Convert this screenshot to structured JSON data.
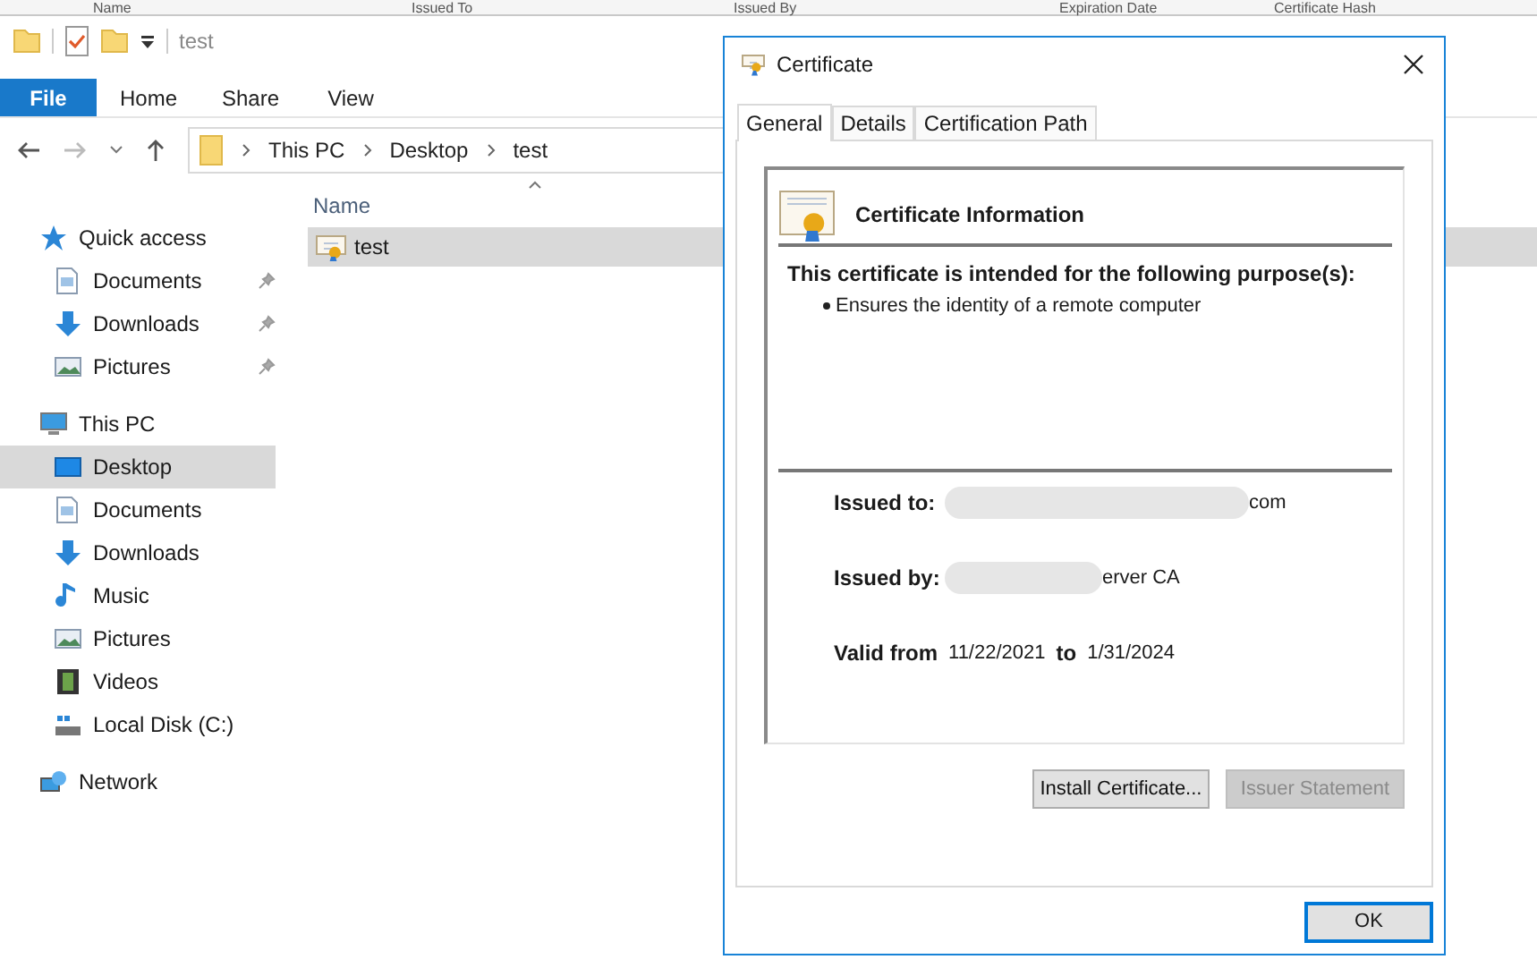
{
  "background_columns": [
    "Name",
    "Issued To",
    "Issued By",
    "Expiration Date",
    "Certificate Hash"
  ],
  "explorer": {
    "title": "test",
    "ribbon_tabs": [
      {
        "label": "File",
        "selected": true
      },
      {
        "label": "Home",
        "selected": false
      },
      {
        "label": "Share",
        "selected": false
      },
      {
        "label": "View",
        "selected": false
      }
    ],
    "breadcrumb": [
      "This PC",
      "Desktop",
      "test"
    ],
    "nav": [
      {
        "label": "Quick access",
        "kind": "star",
        "children": [
          {
            "label": "Documents",
            "kind": "documents",
            "pinned": true,
            "selected": false
          },
          {
            "label": "Downloads",
            "kind": "downloads",
            "pinned": true,
            "selected": false
          },
          {
            "label": "Pictures",
            "kind": "pictures",
            "pinned": true,
            "selected": false
          }
        ]
      },
      {
        "label": "This PC",
        "kind": "pc",
        "children": [
          {
            "label": "Desktop",
            "kind": "desktop",
            "pinned": false,
            "selected": true
          },
          {
            "label": "Documents",
            "kind": "documents",
            "pinned": false,
            "selected": false
          },
          {
            "label": "Downloads",
            "kind": "downloads",
            "pinned": false,
            "selected": false
          },
          {
            "label": "Music",
            "kind": "music",
            "pinned": false,
            "selected": false
          },
          {
            "label": "Pictures",
            "kind": "pictures",
            "pinned": false,
            "selected": false
          },
          {
            "label": "Videos",
            "kind": "videos",
            "pinned": false,
            "selected": false
          },
          {
            "label": "Local Disk (C:)",
            "kind": "disk",
            "pinned": false,
            "selected": false
          }
        ]
      },
      {
        "label": "Network",
        "kind": "network"
      }
    ],
    "column": "Name",
    "files": [
      {
        "name": "test",
        "selected": true
      }
    ]
  },
  "dialog": {
    "title": "Certificate",
    "tabs": [
      {
        "label": "General",
        "selected": true
      },
      {
        "label": "Details",
        "selected": false
      },
      {
        "label": "Certification Path",
        "selected": false
      }
    ],
    "heading": "Certificate Information",
    "purpose_title": "This certificate is intended for the following purpose(s):",
    "purposes": [
      "Ensures the identity of a remote computer"
    ],
    "issued_to": {
      "label": "Issued to:",
      "value": "com"
    },
    "issued_by": {
      "label": "Issued by:",
      "value": "erver CA"
    },
    "valid": {
      "label": "Valid from",
      "from": "11/22/2021",
      "to_label": "to",
      "to": "1/31/2024"
    },
    "buttons": [
      {
        "label": "Install Certificate...",
        "disabled": false
      },
      {
        "label": "Issuer Statement",
        "disabled": true
      }
    ],
    "ok": "OK"
  }
}
